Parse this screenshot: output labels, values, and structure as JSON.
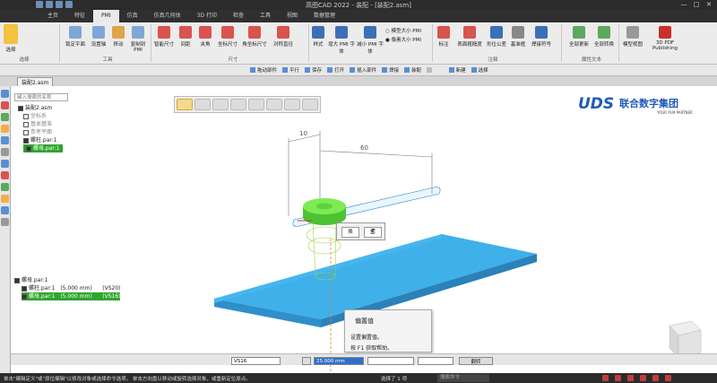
{
  "app": {
    "title": "高图CAD 2022 - 装配 - [装配2.asm]",
    "window_controls": [
      "—",
      "□",
      "✕"
    ]
  },
  "tabs": [
    {
      "label": "主页",
      "active": false
    },
    {
      "label": "特征",
      "active": false
    },
    {
      "label": "PMI",
      "active": true
    },
    {
      "label": "仿真",
      "active": false
    },
    {
      "label": "仿真几何体",
      "active": false
    },
    {
      "label": "3D 打印",
      "active": false
    },
    {
      "label": "检查",
      "active": false
    },
    {
      "label": "工具",
      "active": false
    },
    {
      "label": "视图",
      "active": false
    },
    {
      "label": "数据管理",
      "active": false
    }
  ],
  "ribbon": {
    "select": {
      "label": "选择",
      "group": "选择"
    },
    "tools": {
      "buttons": [
        "锁定平面",
        "设置轴",
        "移动",
        "复制到PMI"
      ],
      "group": "工具"
    },
    "dimension": {
      "buttons": [
        "智能尺寸",
        "间距",
        "夹角",
        "坐标尺寸",
        "角坐标尺寸",
        "对称直径"
      ],
      "group": "尺寸"
    },
    "style": {
      "buttons": [
        "样式",
        "增大 PMI 字体",
        "减小 PMI 字体"
      ],
      "options": [
        "模型大小 PMI",
        "像素大小 PMI"
      ]
    },
    "annotation": {
      "buttons": [
        "标注",
        "表面粗糙度",
        "形位公差",
        "基准框",
        "焊接符号"
      ],
      "group": "注释"
    },
    "attributes": {
      "buttons": [
        "全部更新",
        "全部转换"
      ],
      "group": "属性文本"
    },
    "model_view": {
      "label": "模型视图"
    },
    "publish": {
      "label": "3D PDF Publishing"
    }
  },
  "context_bar": {
    "items": [
      "拖动部件",
      "平行",
      "保存",
      "打开",
      "插入部件",
      "焊接",
      "装配",
      "",
      "新建",
      "选择"
    ],
    "disabled_index": 7
  },
  "document": {
    "tab_label": "装配2.asm"
  },
  "tree": {
    "search_placeholder": "键入搜索的名称",
    "rows": [
      "装配2.asm",
      "坐标系",
      "基本基准",
      "参考平面",
      "螺柱.par:1",
      "螺母.par:1"
    ]
  },
  "popup": {
    "buttons": [
      "换",
      "🗐"
    ]
  },
  "dimensions": {
    "d1": "10",
    "d2": "60"
  },
  "logo": {
    "brand": "UDS",
    "name": "联合数字集团",
    "tagline": "YOUR PLM PARTNER"
  },
  "part_list": {
    "header": "螺母.par:1",
    "rows": [
      {
        "name": "螺柱.par:1",
        "size": "(5.000 mm)",
        "code": "(VS20)"
      },
      {
        "name": "螺母.par:1",
        "size": "(5.000 mm)",
        "code": "(VS16)"
      }
    ]
  },
  "tooltip": {
    "title": "偏置值",
    "line1": "设置偏置值。",
    "line2": "按 F1 获取帮助。"
  },
  "input_bar": {
    "field1": "VS16",
    "offset_value": "25.000 mm",
    "button": "翻转"
  },
  "status": {
    "message": "单击\"编辑定义\"或\"原位编辑\"以修改对象或选择命令选项。 单击方向盘以移动或旋转选择对象，或重新定位原点。",
    "selected": "选择了 1 项",
    "search_placeholder": "搜索命令"
  },
  "colors": {
    "accent": "#2ea52e",
    "plate": "#38a9e6",
    "part": "#6ee04a",
    "brand": "#1e5bb8"
  }
}
